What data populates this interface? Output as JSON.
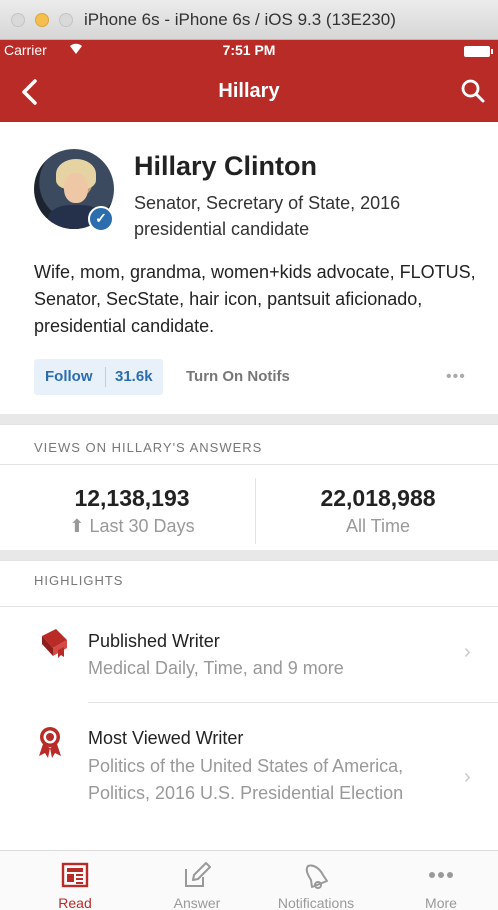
{
  "window": {
    "title": "iPhone 6s - iPhone 6s / iOS 9.3 (13E230)"
  },
  "status": {
    "carrier": "Carrier",
    "time": "7:51 PM"
  },
  "nav": {
    "title": "Hillary",
    "back_icon": "chevron-left-icon",
    "search_icon": "search-icon"
  },
  "profile": {
    "name": "Hillary Clinton",
    "credential": "Senator, Secretary of State, 2016 presidential candidate",
    "bio": "Wife, mom, grandma, women+kids advocate, FLOTUS, Senator, SecState, hair icon, pantsuit aficionado, presidential candidate.",
    "verified": true
  },
  "actions": {
    "follow_label": "Follow",
    "follow_count": "31.6k",
    "notifs_label": "Turn On Notifs",
    "more_label": "•••"
  },
  "views": {
    "header": "VIEWS ON HILLARY'S ANSWERS",
    "last30_value": "12,138,193",
    "last30_label": "Last 30 Days",
    "alltime_value": "22,018,988",
    "alltime_label": "All Time"
  },
  "highlights": {
    "header": "HIGHLIGHTS",
    "items": [
      {
        "title": "Published Writer",
        "subtitle": "Medical Daily, Time, and 9 more",
        "icon": "book-icon"
      },
      {
        "title": "Most Viewed Writer",
        "subtitle": "Politics of the United States of America, Politics, 2016 U.S. Presidential Election",
        "icon": "award-ribbon-icon"
      }
    ]
  },
  "tabs": [
    {
      "label": "Read",
      "icon": "newspaper-icon",
      "active": true
    },
    {
      "label": "Answer",
      "icon": "pencil-icon",
      "active": false
    },
    {
      "label": "Notifications",
      "icon": "bell-icon",
      "active": false
    },
    {
      "label": "More",
      "icon": "dots-icon",
      "active": false
    }
  ],
  "colors": {
    "brand": "#b92b27",
    "link": "#2b6dad",
    "muted": "#999999"
  }
}
